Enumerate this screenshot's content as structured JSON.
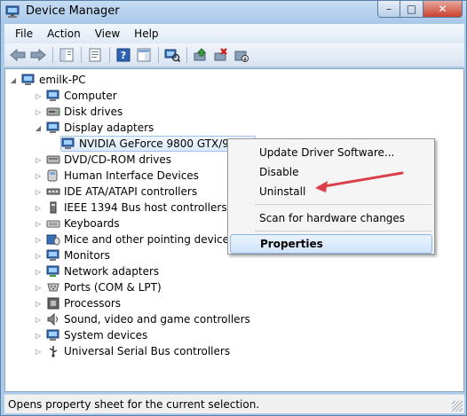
{
  "window": {
    "title": "Device Manager",
    "caption_buttons": [
      "–",
      "□",
      "✕"
    ]
  },
  "menu": [
    "File",
    "Action",
    "View",
    "Help"
  ],
  "toolbar": [
    "back-arrow-icon",
    "forward-arrow-icon",
    "show-hide-console-tree-icon",
    "properties-sheet-icon",
    "help-icon",
    "action-pane-icon",
    "scan-hardware-icon",
    "update-driver-icon",
    "uninstall-icon",
    "disable-device-icon"
  ],
  "tree": {
    "root": "emilk-PC",
    "items": [
      {
        "label": "Computer",
        "icon": "computer-icon"
      },
      {
        "label": "Disk drives",
        "icon": "disk-drive-icon"
      },
      {
        "label": "Display adapters",
        "icon": "display-adapter-icon",
        "expanded": true,
        "children": [
          {
            "label": "NVIDIA GeForce 9800 GTX/9800",
            "icon": "display-adapter-icon",
            "selected": true
          }
        ]
      },
      {
        "label": "DVD/CD-ROM drives",
        "icon": "dvd-drive-icon"
      },
      {
        "label": "Human Interface Devices",
        "icon": "hid-icon"
      },
      {
        "label": "IDE ATA/ATAPI controllers",
        "icon": "ide-controller-icon"
      },
      {
        "label": "IEEE 1394 Bus host controllers",
        "icon": "ieee1394-icon"
      },
      {
        "label": "Keyboards",
        "icon": "keyboard-icon"
      },
      {
        "label": "Mice and other pointing devices",
        "icon": "mouse-icon"
      },
      {
        "label": "Monitors",
        "icon": "monitor-icon"
      },
      {
        "label": "Network adapters",
        "icon": "network-adapter-icon"
      },
      {
        "label": "Ports (COM & LPT)",
        "icon": "port-icon"
      },
      {
        "label": "Processors",
        "icon": "processor-icon"
      },
      {
        "label": "Sound, video and game controllers",
        "icon": "sound-icon"
      },
      {
        "label": "System devices",
        "icon": "system-device-icon"
      },
      {
        "label": "Universal Serial Bus controllers",
        "icon": "usb-icon"
      }
    ]
  },
  "context_menu": {
    "items": [
      "Update Driver Software...",
      "Disable",
      "Uninstall",
      "Scan for hardware changes",
      "Properties"
    ],
    "highlighted": "Properties"
  },
  "annotation": {
    "arrow_color": "#d9404a"
  },
  "status": "Opens property sheet for the current selection.",
  "colors": {
    "titlebar": "#b7d3ee",
    "selection": "#dbeafb",
    "arrow": "#d9404a"
  }
}
